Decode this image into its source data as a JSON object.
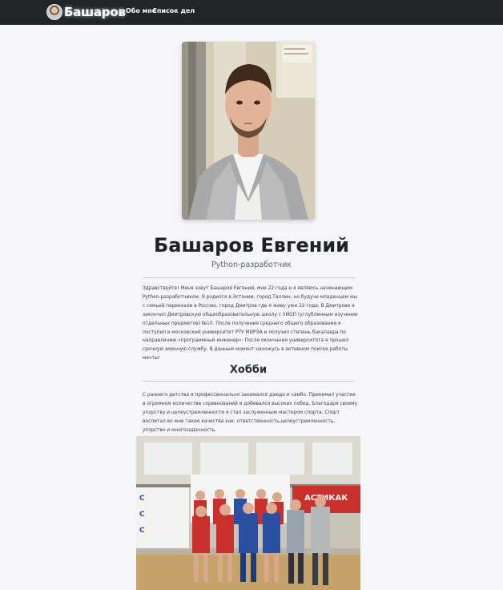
{
  "navbar": {
    "brand_name": "Башаров",
    "brand_avatar_icon": "avatar-icon",
    "links": [
      "Обо мне",
      "Список дел"
    ]
  },
  "profile": {
    "name": "Башаров Евгений",
    "role": "Python-разработчик",
    "about": "Здравствуйте! Меня зовут Башаров Евгений, мне 22 года и я являюсь начинающим Python-разработчиком. Я родился в Эстонии, город Таллин, но будучи младенцем мы с семьей переехали в Россию, город Дмитров где я живу уже 22 года. В Дмитрове я закончил Дмитровскую общеобразовательную школу с УИОП (углубленным изучение отдельных предметов) №10. После получения среднего общего образования я поступил в московский университет РТУ МИРЭА и получил степень бакалавра по направлению «программный инженер». После окончания университета я прошел срочную военную службу. В данным момент нахожусь в активном поиске работы мечты!"
  },
  "hobby": {
    "title": "Хобби",
    "text": "С раннего детства я профессионально занимался дзюдо и самбо. Принимал участие в огромном количестве соревнований и добивался высоких побед. Благодаря своему упорству и целеустремленности я стал заслуженным мастером спорта. Спорт воспитал во мне такие качества как: ответственность,целеустремленность, упорство и многозадачность.",
    "banner_fragment": "АСТИКАК"
  },
  "colors": {
    "navbar_bg": "#212529",
    "page_bg": "#f4f6f9",
    "sambo_red": "#c8302c",
    "sambo_blue": "#2a4fa3"
  }
}
